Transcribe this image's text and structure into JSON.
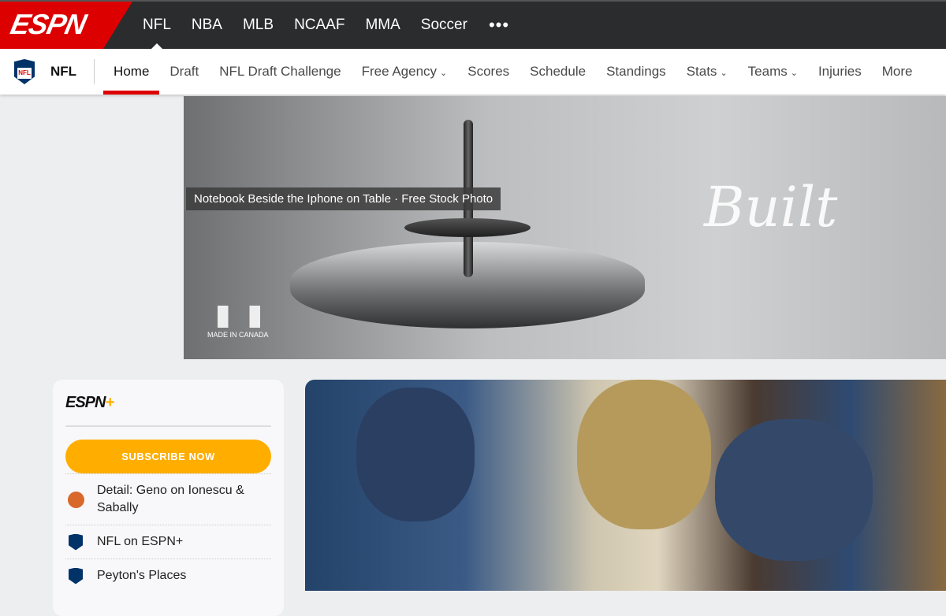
{
  "header": {
    "logo": "ESPN",
    "sports": [
      "NFL",
      "NBA",
      "MLB",
      "NCAAF",
      "MMA",
      "Soccer"
    ],
    "active_sport": "NFL",
    "more_icon": "ellipsis-icon"
  },
  "subnav": {
    "league_logo": "NFL",
    "title": "NFL",
    "items": [
      {
        "label": "Home",
        "dropdown": false
      },
      {
        "label": "Draft",
        "dropdown": false
      },
      {
        "label": "NFL Draft Challenge",
        "dropdown": false
      },
      {
        "label": "Free Agency",
        "dropdown": true
      },
      {
        "label": "Scores",
        "dropdown": false
      },
      {
        "label": "Schedule",
        "dropdown": false
      },
      {
        "label": "Standings",
        "dropdown": false
      },
      {
        "label": "Stats",
        "dropdown": true
      },
      {
        "label": "Teams",
        "dropdown": true
      },
      {
        "label": "Injuries",
        "dropdown": false
      },
      {
        "label": "More",
        "dropdown": true
      }
    ],
    "active": "Home",
    "accent": "#dd0000"
  },
  "banner": {
    "tooltip": "Notebook Beside the Iphone on Table · Free Stock Photo",
    "made_in": "MADE IN CANADA",
    "signature": "Built"
  },
  "espn_plus": {
    "logo": "ESPN+",
    "subscribe_label": "SUBSCRIBE NOW",
    "button_color": "#ffae00",
    "items": [
      {
        "icon": "basketball-icon",
        "label": "Detail: Geno on Ionescu & Sabally"
      },
      {
        "icon": "nfl-shield-icon",
        "label": "NFL on ESPN+"
      },
      {
        "icon": "nfl-shield-icon",
        "label": "Peyton's Places"
      }
    ]
  }
}
